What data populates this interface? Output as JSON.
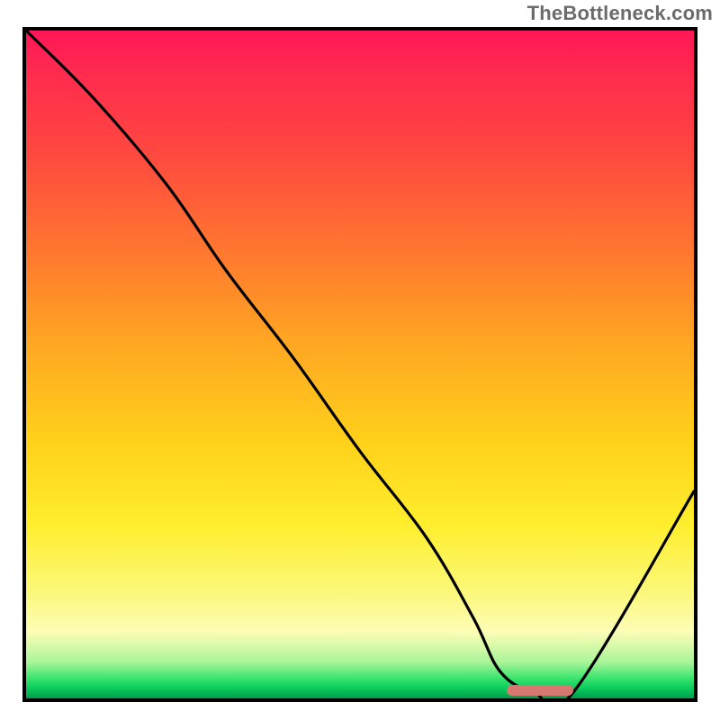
{
  "watermark": "TheBottleneck.com",
  "chart_data": {
    "type": "line",
    "title": "",
    "xlabel": "",
    "ylabel": "",
    "ylim": [
      0,
      100
    ],
    "xlim": [
      0,
      100
    ],
    "series": [
      {
        "name": "bottleneck-curve",
        "x": [
          0,
          10,
          21,
          30,
          40,
          50,
          60,
          67,
          71,
          76,
          82,
          100
        ],
        "values": [
          100,
          90,
          77,
          64,
          51,
          37,
          24,
          12,
          4,
          1,
          1,
          31
        ]
      }
    ],
    "marker": {
      "name": "optimal-range",
      "x_start": 72,
      "x_end": 82,
      "y": 1.2,
      "color": "#d6786f"
    },
    "background_gradient": {
      "top": "#ff1757",
      "upper_mid": "#ffa423",
      "mid": "#ffee2d",
      "lower": "#fdfdb6",
      "bottom_band": "#0acb5e"
    }
  },
  "plot": {
    "inner_w": 742,
    "inner_h": 742
  }
}
